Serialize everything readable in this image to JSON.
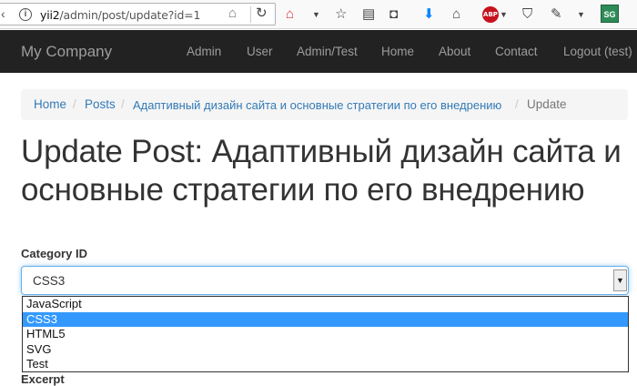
{
  "browser": {
    "url_host": "yii2",
    "url_path": "/admin/post/update?id=1"
  },
  "navbar": {
    "brand": "My Company",
    "items": [
      {
        "label": "Admin"
      },
      {
        "label": "User"
      },
      {
        "label": "Admin/Test"
      },
      {
        "label": "Home"
      },
      {
        "label": "About"
      },
      {
        "label": "Contact"
      },
      {
        "label": "Logout (test)"
      }
    ]
  },
  "breadcrumb": {
    "home": "Home",
    "posts": "Posts",
    "post": "Адаптивный дизайн сайта и основные стратегии по его внедрению",
    "current": "Update",
    "separator": "/"
  },
  "page": {
    "title": "Update Post: Адаптивный дизайн сайта и основные стратегии по его внедрению"
  },
  "form": {
    "category_label": "Category ID",
    "category_value": "CSS3",
    "category_options": [
      "JavaScript",
      "CSS3",
      "HTML5",
      "SVG",
      "Test"
    ],
    "excerpt_label": "Excerpt"
  },
  "icons": {
    "abp": "ABP",
    "sg": "SG"
  }
}
